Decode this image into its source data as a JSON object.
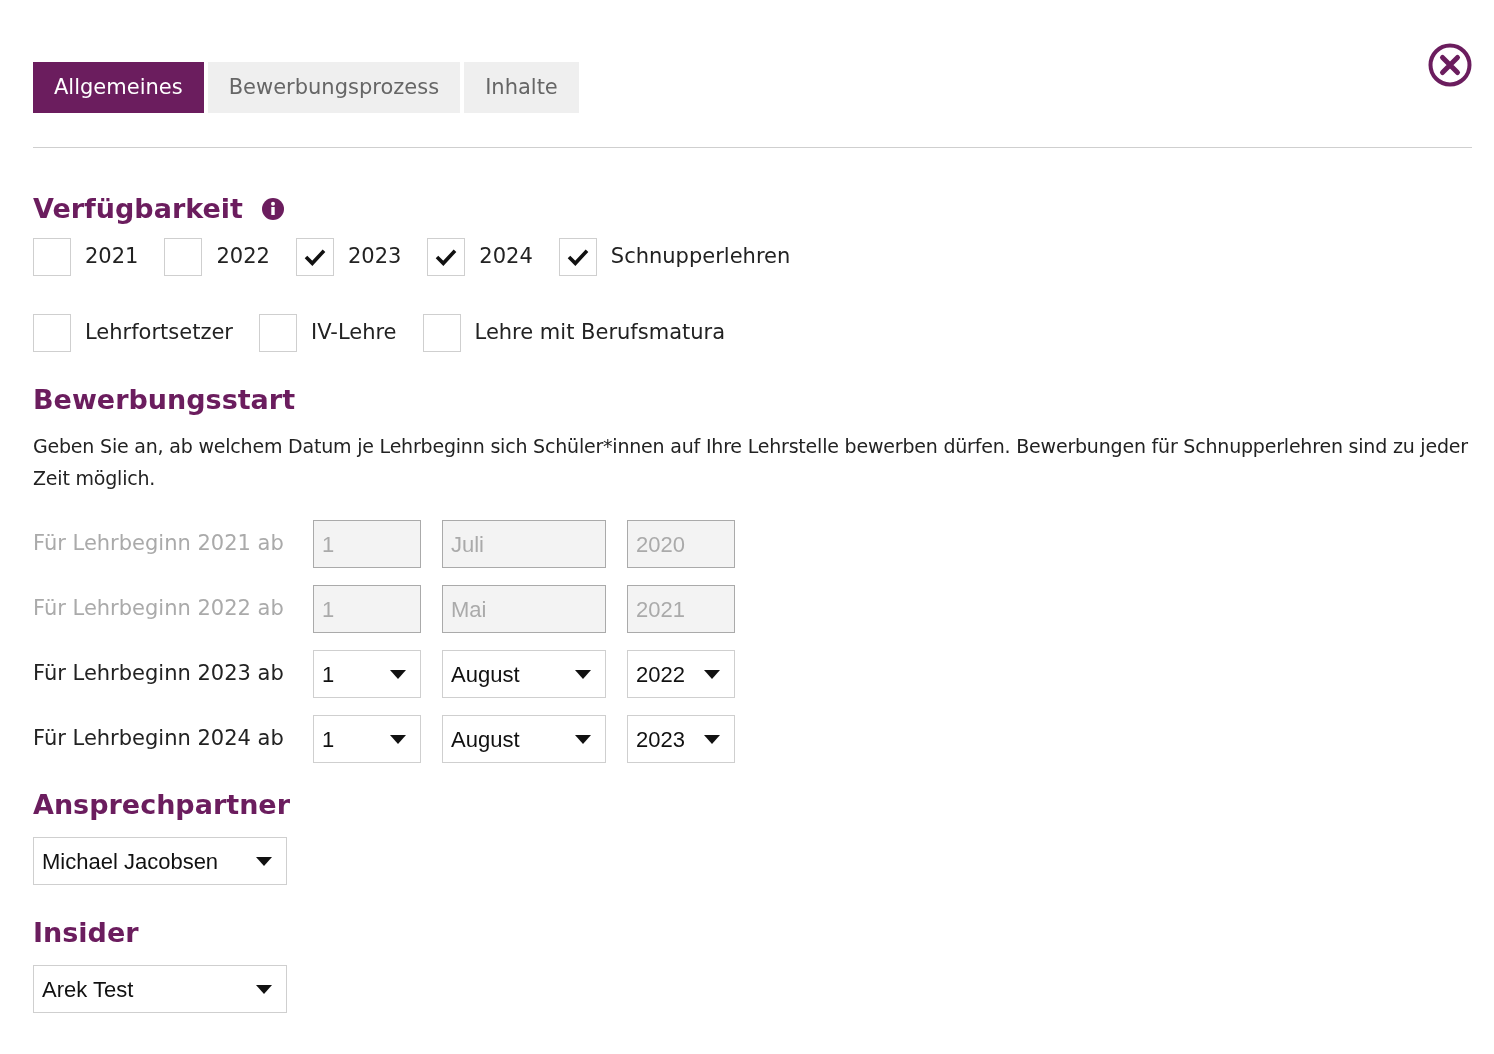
{
  "tabs": [
    {
      "label": "Allgemeines",
      "selected": true
    },
    {
      "label": "Bewerbungsprozess",
      "selected": false
    },
    {
      "label": "Inhalte",
      "selected": false
    }
  ],
  "availability": {
    "title": "Verfügbarkeit",
    "options_row_1": [
      {
        "label": "2021",
        "checked": false
      },
      {
        "label": "2022",
        "checked": false
      },
      {
        "label": "2023",
        "checked": true
      },
      {
        "label": "2024",
        "checked": true
      },
      {
        "label": "Schnupperlehren",
        "checked": true
      }
    ],
    "options_row_2": [
      {
        "label": "Lehrfortsetzer",
        "checked": false
      },
      {
        "label": "IV-Lehre",
        "checked": false
      },
      {
        "label": "Lehre mit Berufsmatura",
        "checked": false
      }
    ]
  },
  "application_start": {
    "title": "Bewerbungsstart",
    "description": "Geben Sie an, ab welchem Datum je Lehrbeginn sich Schüler*innen auf Ihre Lehrstelle bewerben dürfen. Bewerbungen für Schnupperlehren sind zu jeder Zeit möglich.",
    "rows": [
      {
        "label": "Für Lehrbeginn 2021 ab",
        "disabled": true,
        "day": "1",
        "month": "Juli",
        "year": "2020"
      },
      {
        "label": "Für Lehrbeginn 2022 ab",
        "disabled": true,
        "day": "1",
        "month": "Mai",
        "year": "2021"
      },
      {
        "label": "Für Lehrbeginn 2023 ab",
        "disabled": false,
        "day": "1",
        "month": "August",
        "year": "2022"
      },
      {
        "label": "Für Lehrbeginn 2024 ab",
        "disabled": false,
        "day": "1",
        "month": "August",
        "year": "2023"
      }
    ]
  },
  "contact": {
    "title": "Ansprechpartner",
    "value": "Michael Jacobsen"
  },
  "insider": {
    "title": "Insider",
    "value": "Arek Test"
  }
}
